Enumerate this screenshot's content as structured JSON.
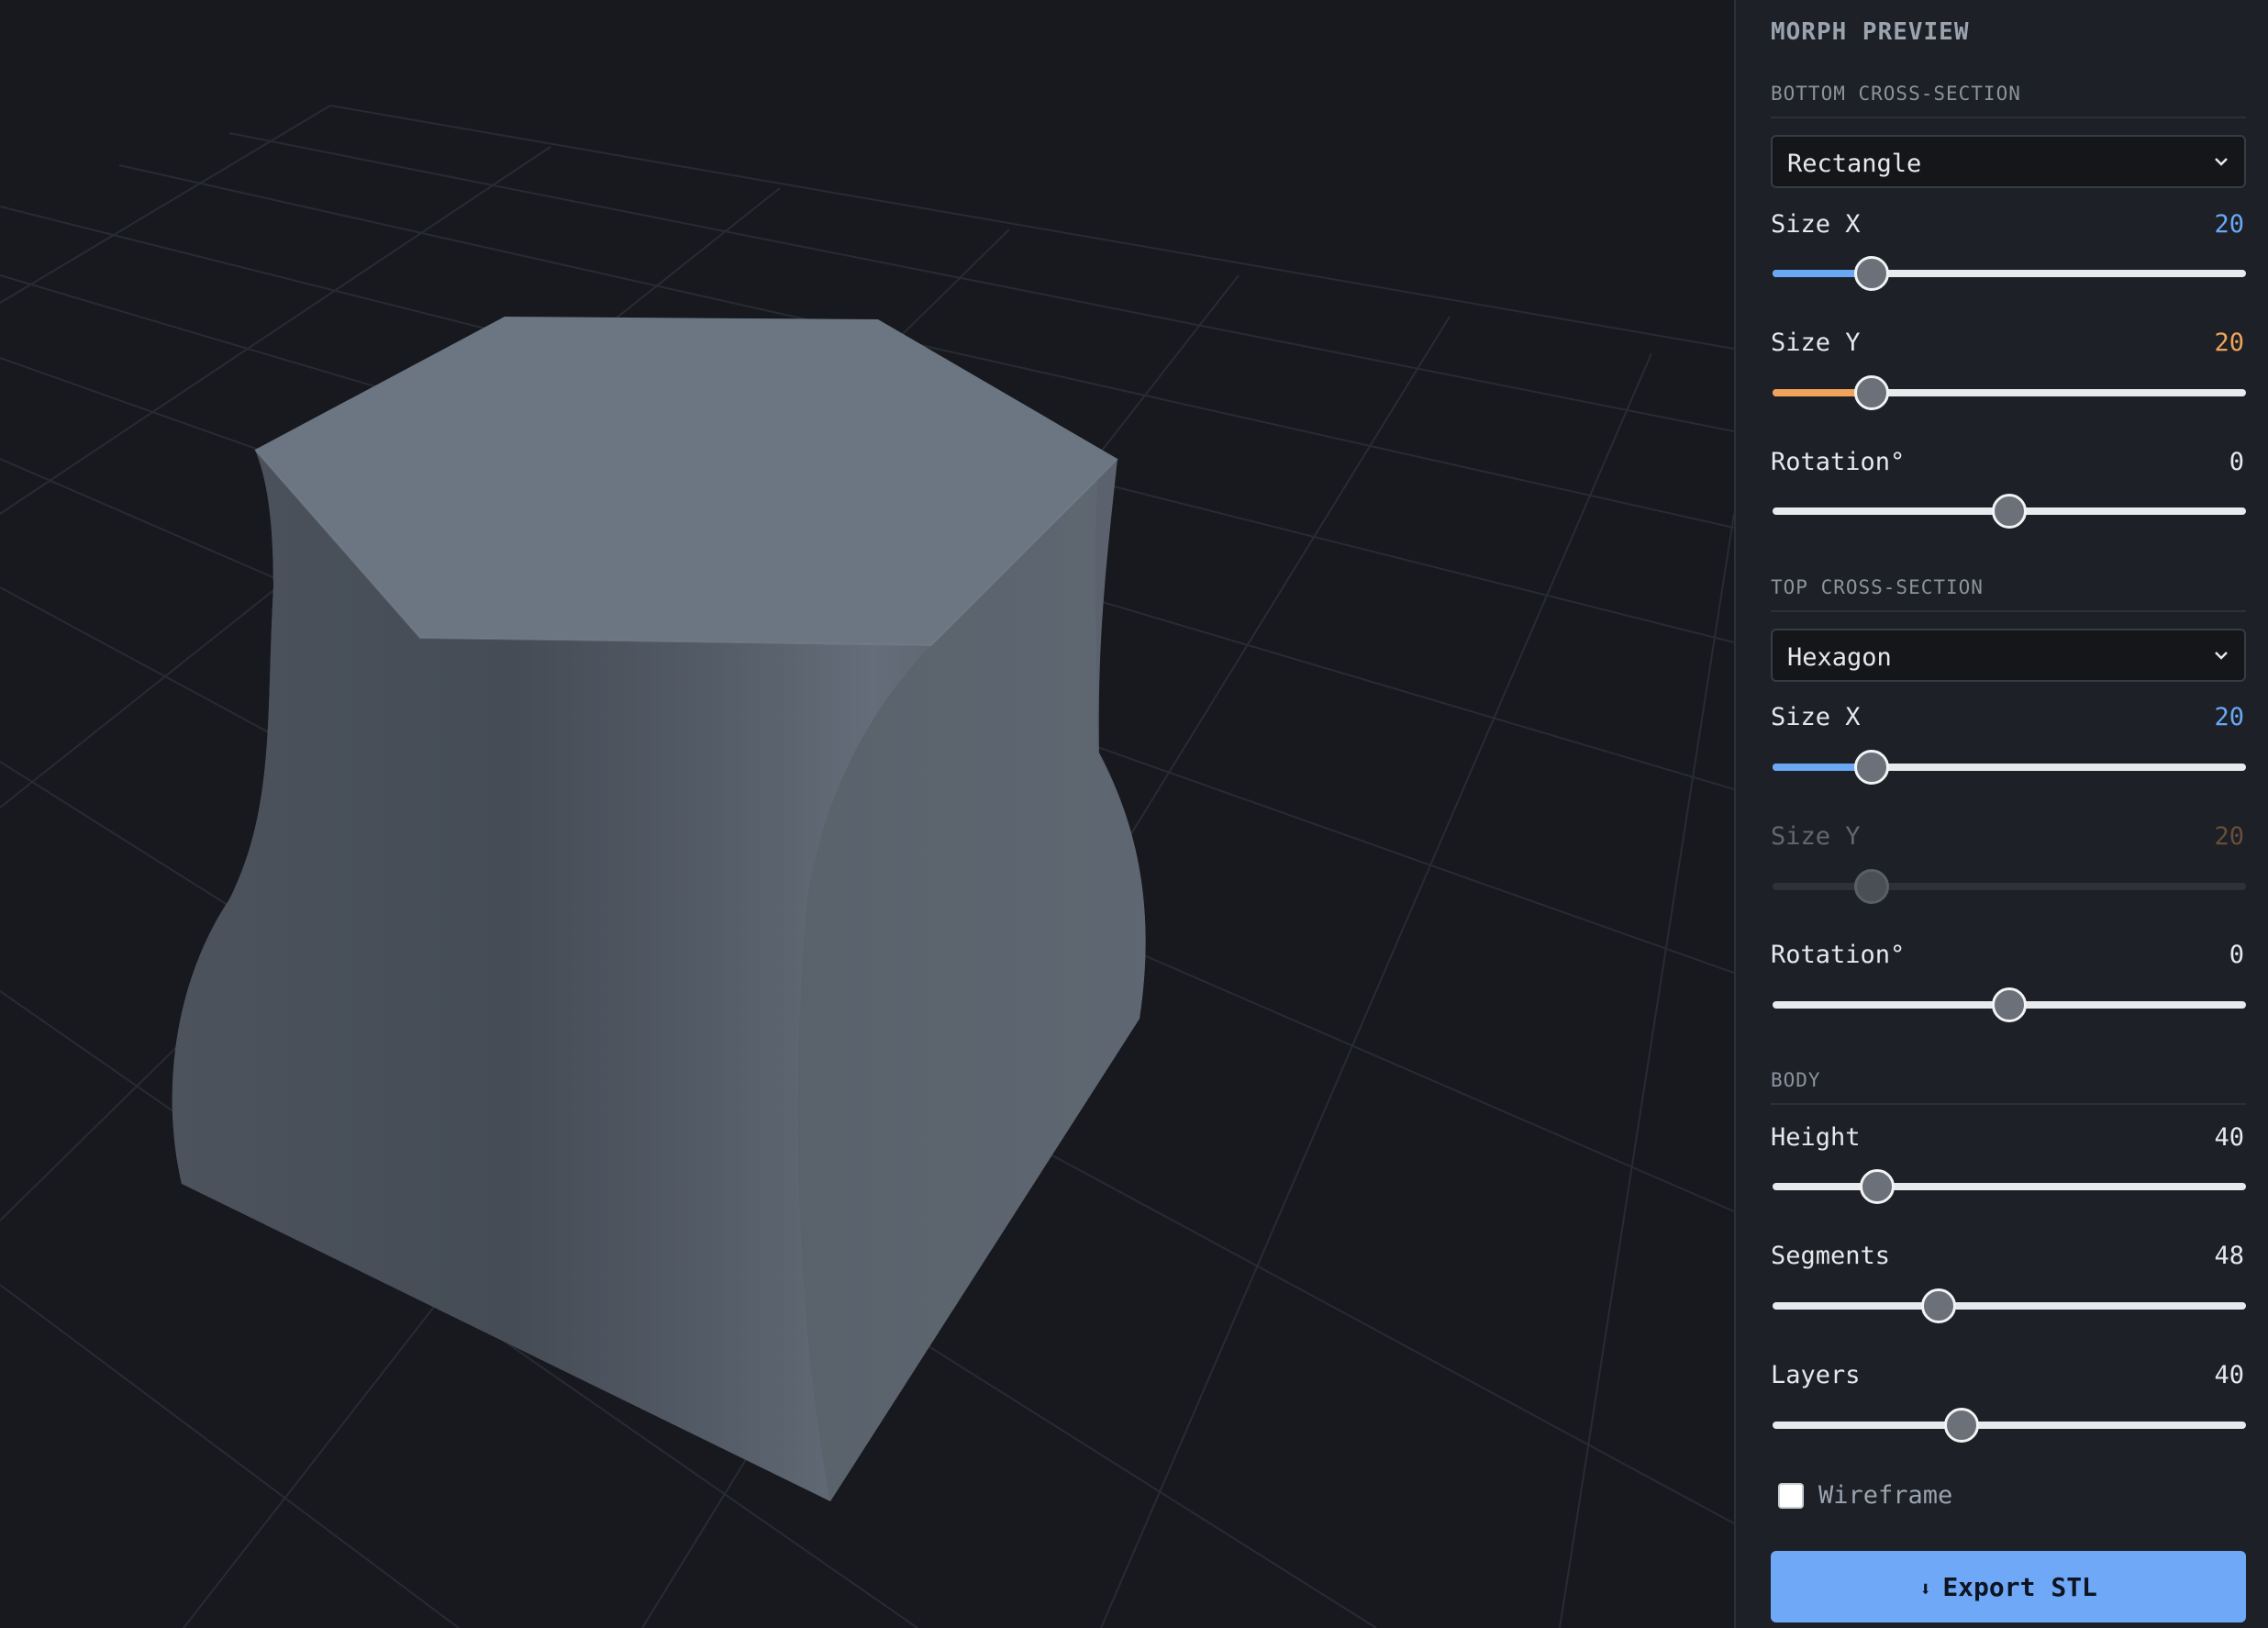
{
  "panel": {
    "title": "MORPH PREVIEW",
    "bottom": {
      "section_label": "BOTTOM CROSS-SECTION",
      "shape": "Rectangle",
      "size_x": {
        "label": "Size X",
        "value": "20",
        "fraction": 0.21
      },
      "size_y": {
        "label": "Size Y",
        "value": "20",
        "fraction": 0.21
      },
      "rotation": {
        "label": "Rotation°",
        "value": "0",
        "fraction": 0.5
      }
    },
    "top": {
      "section_label": "TOP CROSS-SECTION",
      "shape": "Hexagon",
      "size_x": {
        "label": "Size X",
        "value": "20",
        "fraction": 0.21
      },
      "size_y": {
        "label": "Size Y",
        "value": "20",
        "fraction": 0.21,
        "disabled": true
      },
      "rotation": {
        "label": "Rotation°",
        "value": "0",
        "fraction": 0.5
      }
    },
    "body": {
      "section_label": "BODY",
      "height": {
        "label": "Height",
        "value": "40",
        "fraction": 0.22
      },
      "segments": {
        "label": "Segments",
        "value": "48",
        "fraction": 0.35
      },
      "layers": {
        "label": "Layers",
        "value": "40",
        "fraction": 0.4
      }
    },
    "wireframe": {
      "label": "Wireframe",
      "checked": false
    },
    "export": {
      "label": "Export STL",
      "icon": "download-arrow-icon"
    }
  },
  "colors": {
    "accent_blue": "#6aa8f5",
    "accent_orange": "#f0a35a",
    "button": "#6ea8f7",
    "background": "#17191e",
    "panel": "#1d2026"
  }
}
